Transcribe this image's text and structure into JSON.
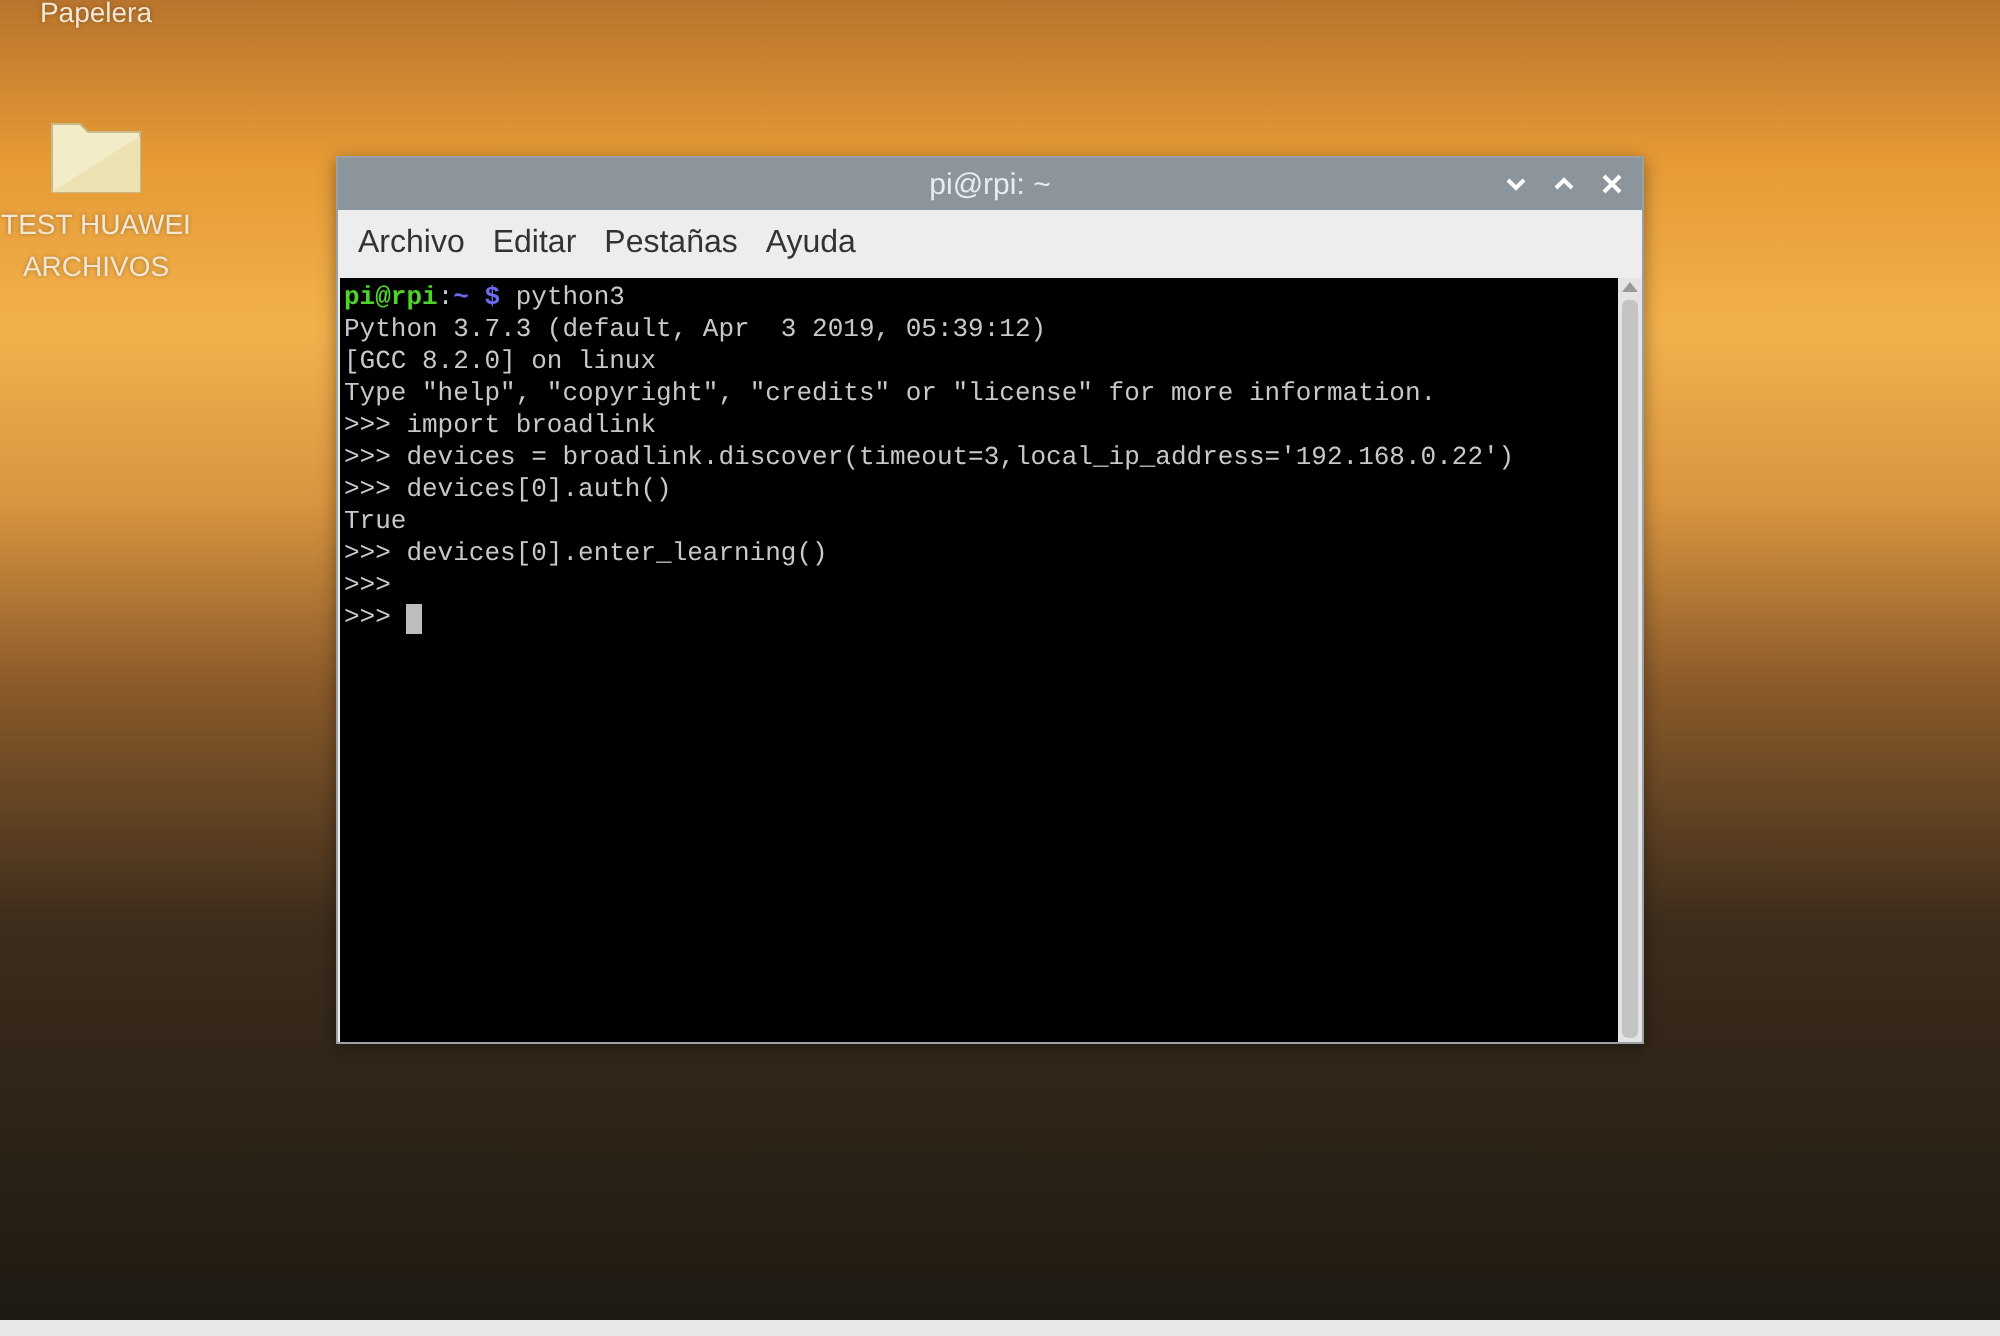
{
  "desktop": {
    "icons": [
      {
        "label": "Papelera",
        "kind": "label-only"
      },
      {
        "label": "TEST HUAWEI ARCHIVOS",
        "kind": "folder"
      }
    ]
  },
  "window": {
    "title": "pi@rpi: ~",
    "controls": [
      {
        "kind": "minimize"
      },
      {
        "kind": "maximize"
      },
      {
        "kind": "close"
      }
    ],
    "menu": [
      "Archivo",
      "Editar",
      "Pestañas",
      "Ayuda"
    ],
    "terminal": {
      "prompt": {
        "user": "pi@rpi",
        "separator": ":",
        "path": "~",
        "symbol": "$",
        "command": "python3"
      },
      "lines": [
        {
          "text": "Python 3.7.3 (default, Apr  3 2019, 05:39:12)",
          "cursor": false
        },
        {
          "text": "[GCC 8.2.0] on linux",
          "cursor": false
        },
        {
          "text": "Type \"help\", \"copyright\", \"credits\" or \"license\" for more information.",
          "cursor": false
        },
        {
          "text": ">>> import broadlink",
          "cursor": false
        },
        {
          "text": ">>> devices = broadlink.discover(timeout=3,local_ip_address='192.168.0.22')",
          "cursor": false
        },
        {
          "text": ">>> devices[0].auth()",
          "cursor": false
        },
        {
          "text": "True",
          "cursor": false
        },
        {
          "text": ">>> devices[0].enter_learning()",
          "cursor": false
        },
        {
          "text": ">>>",
          "cursor": false
        },
        {
          "text": ">>>",
          "cursor": true
        }
      ]
    }
  }
}
